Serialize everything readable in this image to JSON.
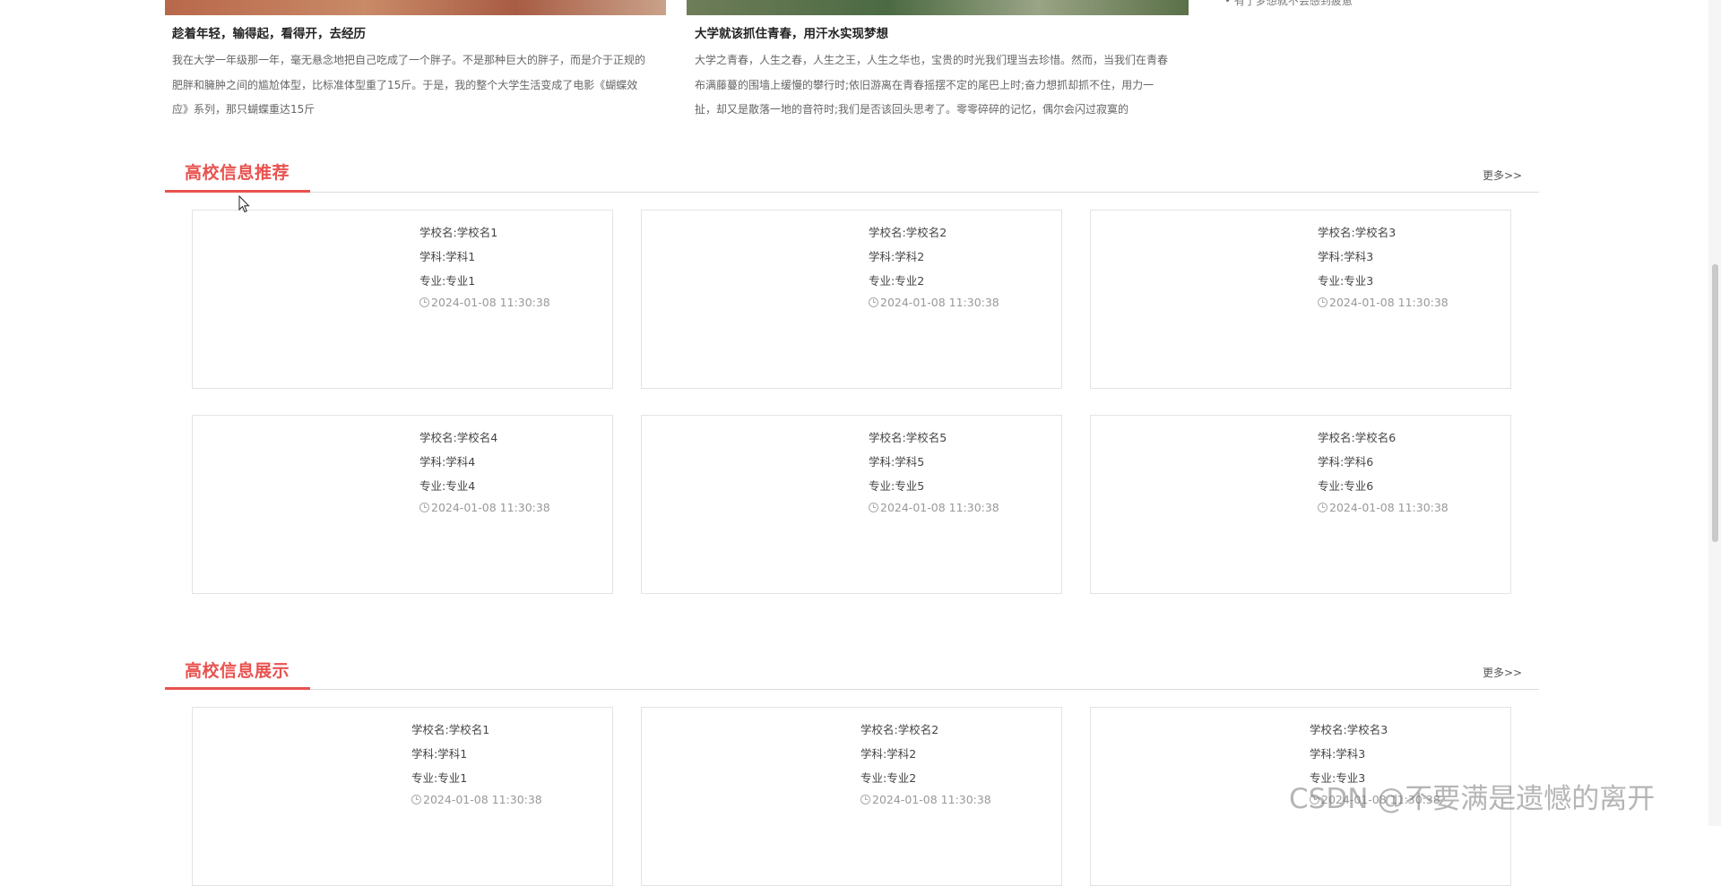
{
  "news": [
    {
      "title": "趁着年轻，输得起，看得开，去经历",
      "desc": "我在大学一年级那一年，毫无悬念地把自己吃成了一个胖子。不是那种巨大的胖子，而是介于正规的肥胖和臃肿之间的尴尬体型，比标准体型重了15斤。于是，我的整个大学生活变成了电影《蝴蝶效应》系列，那只蝴蝶重达15斤"
    },
    {
      "title": "大学就该抓住青春，用汗水实现梦想",
      "desc": "大学之青春，人生之春，人生之王，人生之华也，宝贵的时光我们理当去珍惜。然而，当我们在青春布满藤蔓的围墙上缓慢的攀行时;依旧游离在青春摇摆不定的尾巴上时;奋力想抓却抓不住，用力一扯，却又是散落一地的音符时;我们是否该回头思考了。零零碎碎的记忆，偶尔会闪过寂寞的"
    }
  ],
  "side_snippet": "• 有了梦想就不会感到疲惫",
  "sections": [
    {
      "title": "高校信息推荐",
      "more": "更多>>",
      "cards": [
        {
          "school": "学校名:学校名1",
          "subject": "学科:学科1",
          "major": "专业:专业1",
          "time": "2024-01-08 11:30:38"
        },
        {
          "school": "学校名:学校名2",
          "subject": "学科:学科2",
          "major": "专业:专业2",
          "time": "2024-01-08 11:30:38"
        },
        {
          "school": "学校名:学校名3",
          "subject": "学科:学科3",
          "major": "专业:专业3",
          "time": "2024-01-08 11:30:38"
        },
        {
          "school": "学校名:学校名4",
          "subject": "学科:学科4",
          "major": "专业:专业4",
          "time": "2024-01-08 11:30:38"
        },
        {
          "school": "学校名:学校名5",
          "subject": "学科:学科5",
          "major": "专业:专业5",
          "time": "2024-01-08 11:30:38"
        },
        {
          "school": "学校名:学校名6",
          "subject": "学科:学科6",
          "major": "专业:专业6",
          "time": "2024-01-08 11:30:38"
        }
      ]
    },
    {
      "title": "高校信息展示",
      "more": "更多>>",
      "cards": [
        {
          "school": "学校名:学校名1",
          "subject": "学科:学科1",
          "major": "专业:专业1",
          "time": "2024-01-08 11:30:38"
        },
        {
          "school": "学校名:学校名2",
          "subject": "学科:学科2",
          "major": "专业:专业2",
          "time": "2024-01-08 11:30:38"
        },
        {
          "school": "学校名:学校名3",
          "subject": "学科:学科3",
          "major": "专业:专业3",
          "time": "2024-01-08 11:30:38"
        }
      ]
    }
  ],
  "watermark": "CSDN @不要满是遗憾的离开",
  "colors": {
    "accent": "#e9524f"
  }
}
